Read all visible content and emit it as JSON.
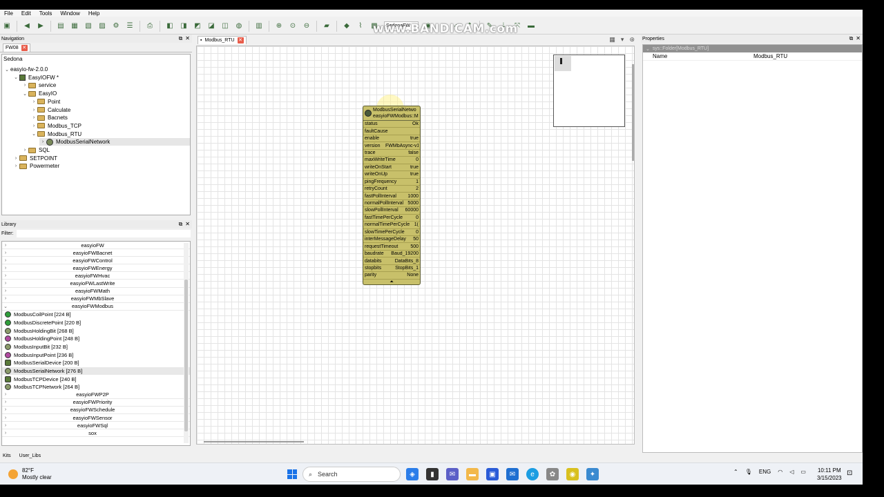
{
  "menu": [
    "File",
    "Edit",
    "Tools",
    "Window",
    "Help"
  ],
  "watermark": "www.BANDICAM.com",
  "toolbar": {
    "combo": "SedonaFW"
  },
  "navigation": {
    "title": "Navigation",
    "tab": "FW08",
    "root": "Sedona",
    "nodes": [
      {
        "label": "easyio-fw-2.0.0",
        "level": 0,
        "arrow": "⌄",
        "icon": "none"
      },
      {
        "label": "EasyIOFW *",
        "level": 1,
        "arrow": "⌄",
        "icon": "device"
      },
      {
        "label": "service",
        "level": 2,
        "arrow": "›",
        "icon": "folder"
      },
      {
        "label": "EasyIO",
        "level": 2,
        "arrow": "⌄",
        "icon": "folder"
      },
      {
        "label": "Point",
        "level": 3,
        "arrow": "›",
        "icon": "folder"
      },
      {
        "label": "Calculate",
        "level": 3,
        "arrow": "›",
        "icon": "folder"
      },
      {
        "label": "Bacnets",
        "level": 3,
        "arrow": "›",
        "icon": "folder"
      },
      {
        "label": "Modbus_TCP",
        "level": 3,
        "arrow": "›",
        "icon": "folder"
      },
      {
        "label": "Modbus_RTU",
        "level": 3,
        "arrow": "⌄",
        "icon": "folder"
      },
      {
        "label": "ModbusSerialNetwork",
        "level": 4,
        "arrow": "›",
        "icon": "network",
        "selected": true
      },
      {
        "label": "SQL",
        "level": 2,
        "arrow": "›",
        "icon": "folder"
      },
      {
        "label": "SETPOINT",
        "level": 1,
        "arrow": "›",
        "icon": "folder"
      },
      {
        "label": "Powermeter",
        "level": 1,
        "arrow": "›",
        "icon": "folder"
      }
    ]
  },
  "library": {
    "title": "Library",
    "filter_label": "Filter:",
    "kits_top": [
      "easyioFW",
      "easyioFWBacnet",
      "easyioFWControl",
      "easyioFWEnergy",
      "easyioFWHvac",
      "easyioFWLastWrite",
      "easyioFWMath",
      "easyioFWMbSlave"
    ],
    "open_kit": "easyioFWModbus",
    "components": [
      {
        "label": "ModbusCoilPoint [224 B]",
        "icon": "g"
      },
      {
        "label": "ModbusDiscretePoint [220 B]",
        "icon": "g"
      },
      {
        "label": "ModbusHoldingBit [268 B]",
        "icon": "gear"
      },
      {
        "label": "ModbusHoldingPoint [248 B]",
        "icon": "p"
      },
      {
        "label": "ModbusInputBit [232 B]",
        "icon": "gear"
      },
      {
        "label": "ModbusInputPoint [236 B]",
        "icon": "p"
      },
      {
        "label": "ModbusSerialDevice [200 B]",
        "icon": "o"
      },
      {
        "label": "ModbusSerialNetwork [276 B]",
        "icon": "gear",
        "selected": true
      },
      {
        "label": "ModbusTCPDevice [240 B]",
        "icon": "o"
      },
      {
        "label": "ModbusTCPNetwork [264 B]",
        "icon": "gear"
      }
    ],
    "kits_bottom": [
      "easyioFWP2P",
      "easyioFWPriority",
      "easyioFWSchedule",
      "easyioFWSensor",
      "easyioFWSql",
      "sox"
    ],
    "tabs": [
      "Kits",
      "User_Libs"
    ]
  },
  "editor": {
    "tab": "Modbus_RTU",
    "component": {
      "title_line1": "ModbusSerialNetwo",
      "title_line2": "easyioFWModbus::M",
      "slots": [
        {
          "k": "status",
          "v": "Ok"
        },
        {
          "k": "faultCause",
          "v": ""
        },
        {
          "k": "enable",
          "v": "true"
        },
        {
          "k": "version",
          "v": "FWMbAsync-v1"
        },
        {
          "k": "trace",
          "v": "false"
        },
        {
          "k": "maxWriteTime",
          "v": "0"
        },
        {
          "k": "writeOnStart",
          "v": "true"
        },
        {
          "k": "writeOnUp",
          "v": "true"
        },
        {
          "k": "pingFrequency",
          "v": "1"
        },
        {
          "k": "retryCount",
          "v": "2"
        },
        {
          "k": "fastPollInterval",
          "v": "1000"
        },
        {
          "k": "normalPollInterval",
          "v": "5000"
        },
        {
          "k": "slowPollInterval",
          "v": "60000"
        },
        {
          "k": "fastTimePerCycle",
          "v": "0"
        },
        {
          "k": "normalTimePerCycle",
          "v": "1("
        },
        {
          "k": "slowTimePerCycle",
          "v": "0"
        },
        {
          "k": "interMessageDelay",
          "v": "50"
        },
        {
          "k": "requestTimeout",
          "v": "500"
        },
        {
          "k": "baudrate",
          "v": "Baud_19200"
        },
        {
          "k": "databits",
          "v": "DataBits_8"
        },
        {
          "k": "stopbits",
          "v": "StopBits_1"
        },
        {
          "k": "parity",
          "v": "None"
        }
      ]
    }
  },
  "properties": {
    "title": "Properties",
    "header": "sys::Folder[Modbus_RTU]",
    "rows": [
      {
        "k": "Name",
        "v": "Modbus_RTU"
      }
    ]
  },
  "taskbar": {
    "temp": "82°F",
    "weather": "Mostly clear",
    "search": "Search",
    "lang": "ENG",
    "time": "10:11 PM",
    "date": "3/15/2023"
  }
}
